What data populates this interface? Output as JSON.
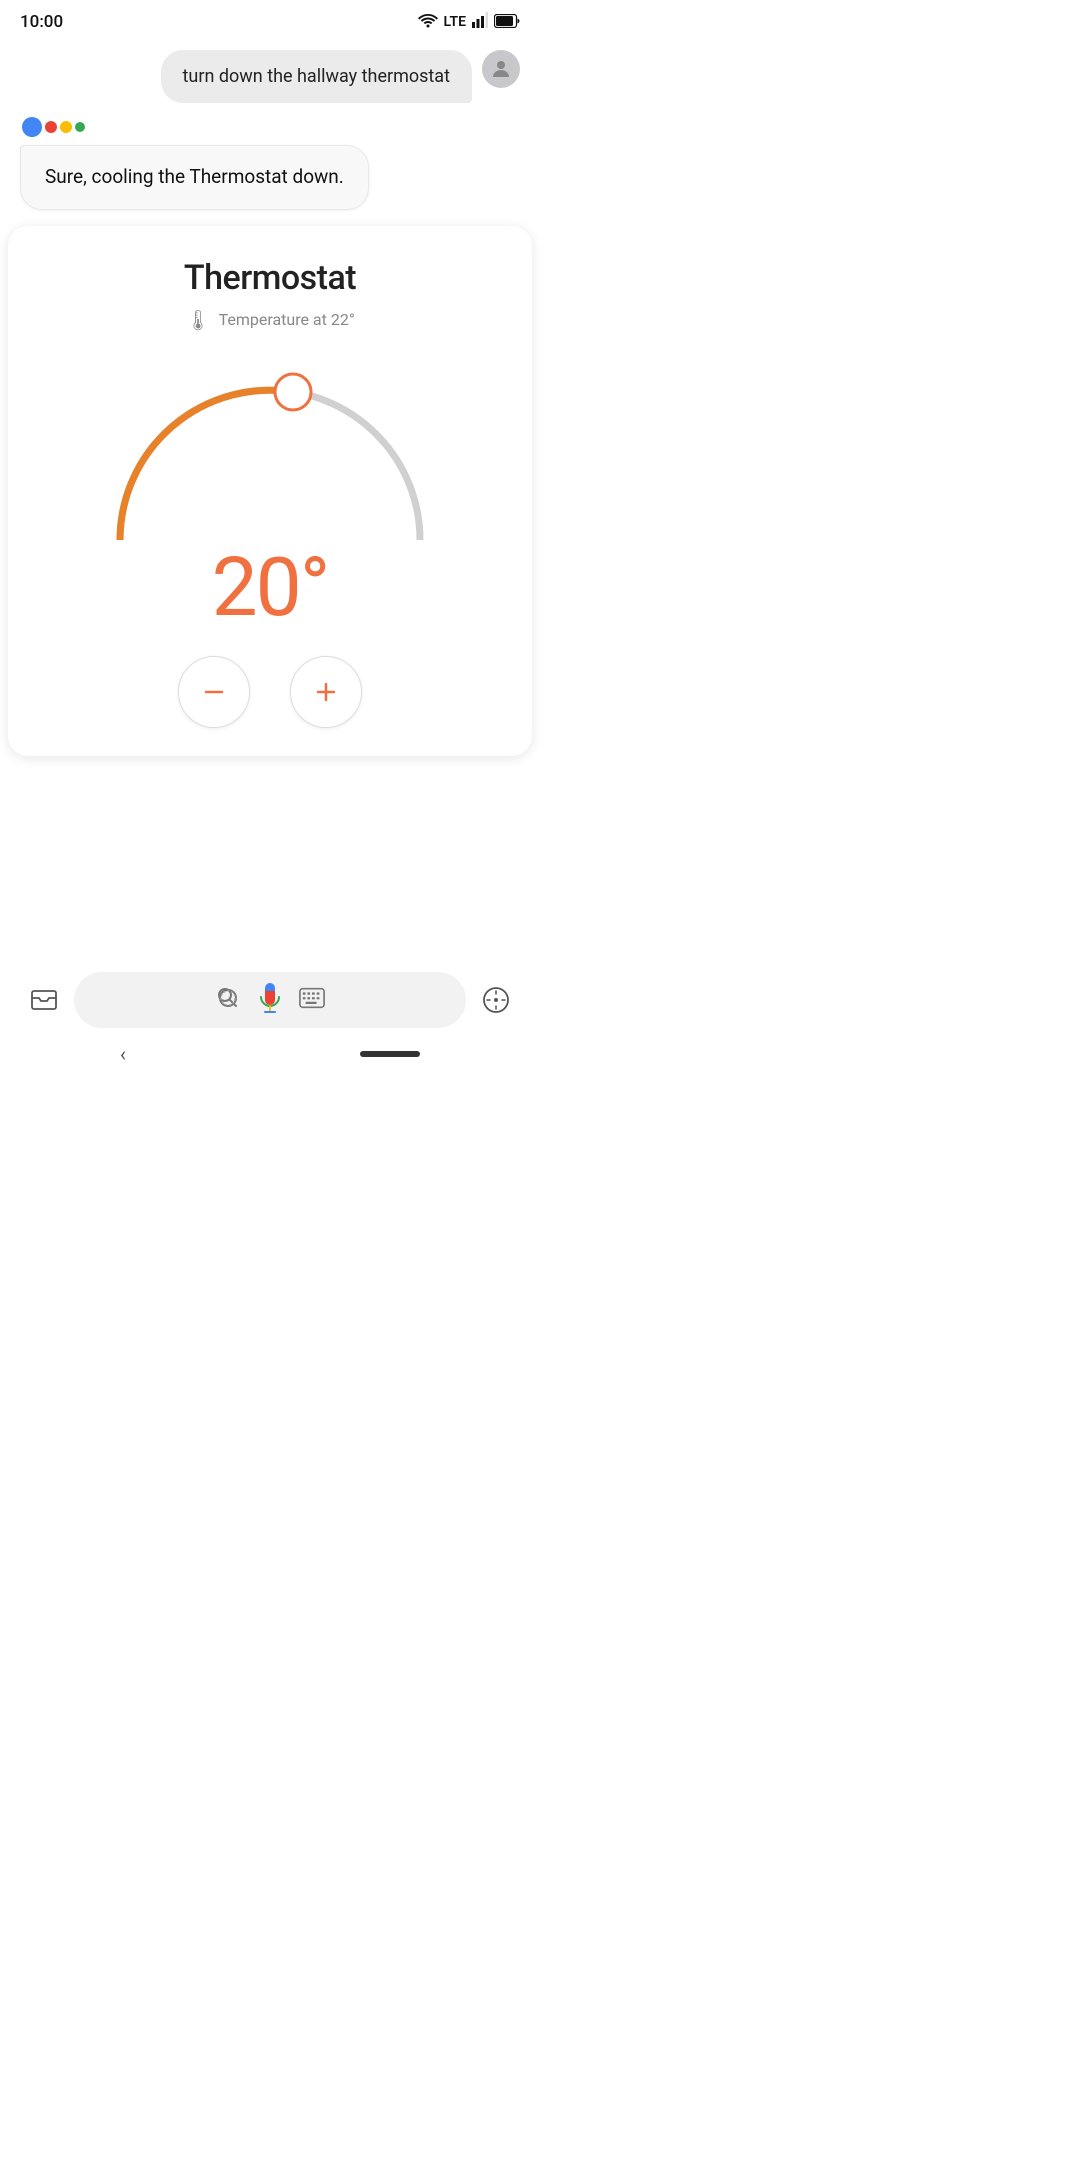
{
  "status": {
    "time": "10:00",
    "wifi": true,
    "lte": true,
    "battery": true
  },
  "user_message": {
    "text": "turn down the hallway thermostat"
  },
  "assistant_message": {
    "text": "Sure, cooling the Thermostat down."
  },
  "thermostat": {
    "title": "Thermostat",
    "temp_label": "Temperature at 22°",
    "current_temp": "20°",
    "min_temp": 10,
    "max_temp": 30,
    "set_temp": 20,
    "arc_temp": 22,
    "dial_color_active": "#E8822A",
    "dial_color_inactive": "#cccccc",
    "dial_handle_color": "#F07040",
    "temp_color": "#F07040"
  },
  "controls": {
    "decrease_label": "−",
    "increase_label": "+"
  },
  "nav": {
    "back_label": "‹",
    "mic_active": true
  }
}
